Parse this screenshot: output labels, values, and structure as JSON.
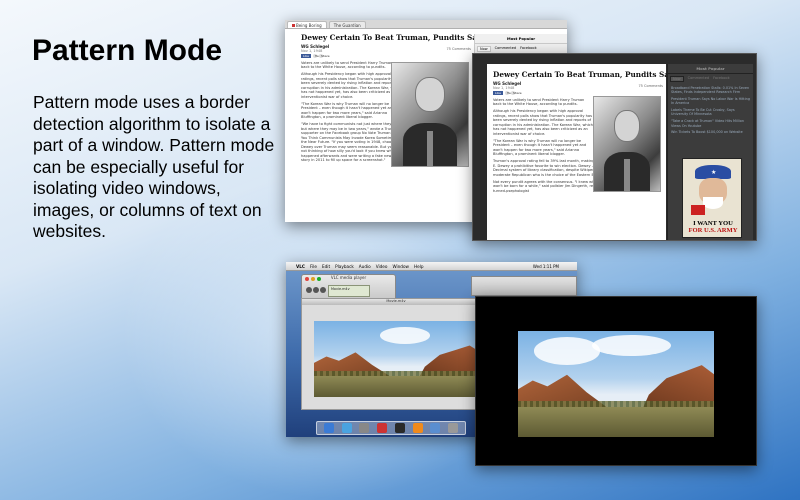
{
  "hero": {
    "title": "Pattern Mode",
    "description": "Pattern mode uses a border detection algorithm to isolate a part of a window. Pattern mode can be especially useful for isolating video windows, images, or columns of text on websites."
  },
  "browser": {
    "tabs": [
      "Being Boring",
      "The Guardian"
    ],
    "headline": "Dewey Certain To Beat Truman, Pundits Say",
    "byline": "WG Schlegel",
    "date": "Nov 1, 1948",
    "share_buttons": [
      "Like",
      "Tweet",
      "Share"
    ],
    "comments": "75 Comments",
    "paragraphs": [
      "Voters are unlikely to send President Harry Truman back to the White House, according to pundits.",
      "Although his Presidency began with high approval ratings, recent polls show that Truman's popularity has been severely dented by rising inflation and reports of corruption in his administration. The Korean War, which has not happened yet, has also been criticized as an interventionist war of choice.",
      "\"The Korean War is why Truman will no longer be President – even though it hasn't happened yet and won't happen for two more years,\" said Arianna Bluffington, a prominent liberal blogger.",
      "\"We have to fight communists not just where they are, but where they may be in two years,\" wrote a Truman supporter on the Facebook group No Vote Truman If You Think Communists May Invade Korea Sometime In the Near Future. \"If you were voting in 1948, choosing Dewey over Truman may seem reasonable. But you are not thinking of how silly you'd look if you knew what happened afterwards and were writing a fake news story in 2011 to fill up space for a screenshot.\"",
      "Truman's approval rating fell to 39% last month, making the Republican nominee Thomas E. Dewey a prohibitive favorite to win election. Dewey – who did not create the Dewey Decimal system of library classification, despite Wikipedia assertions to the contrary – is a moderate Republican who is the choice of the Eastern Establishment.",
      "Not every pundit agrees with the consensus. \"I knew what Nate Silver would say. But he won't be born for a while,\" said pollster Jim Dingerth, referring to the sabermetrician-turned-psephologist"
    ],
    "sidebar_title": "Most Popular",
    "sidebar_tabs": [
      "Now",
      "Commented",
      "Facebook"
    ],
    "sidebar_links": [
      "Broadband Penetration Stalls: 0.01% In Seven States, Finds Independent Research Firm",
      "President Truman Says No Labor War Is Hitting In America",
      "Labels Theme To Be Cut Crosby, Says University Of Minnesota",
      "\"Take a Crack at Truman\" Video Hits Million Views On Youtube",
      "Win Tickets To Boost $100,000 on Website"
    ],
    "poster_lines": [
      "I WANT YOU",
      "FOR U.S. ARMY"
    ]
  },
  "vlc": {
    "menu_items": [
      "VLC",
      "File",
      "Edit",
      "Playback",
      "Audio",
      "Video",
      "Window",
      "Help"
    ],
    "clock": "Wed 1:11 PM",
    "window_title": "VLC media player",
    "lcd_text": "Movie.m4v",
    "video_title": "Movie.m4v"
  },
  "colors": {
    "background_top": "#f4f8fc",
    "background_bottom": "#2f73c2",
    "dark_window": "#000000"
  }
}
